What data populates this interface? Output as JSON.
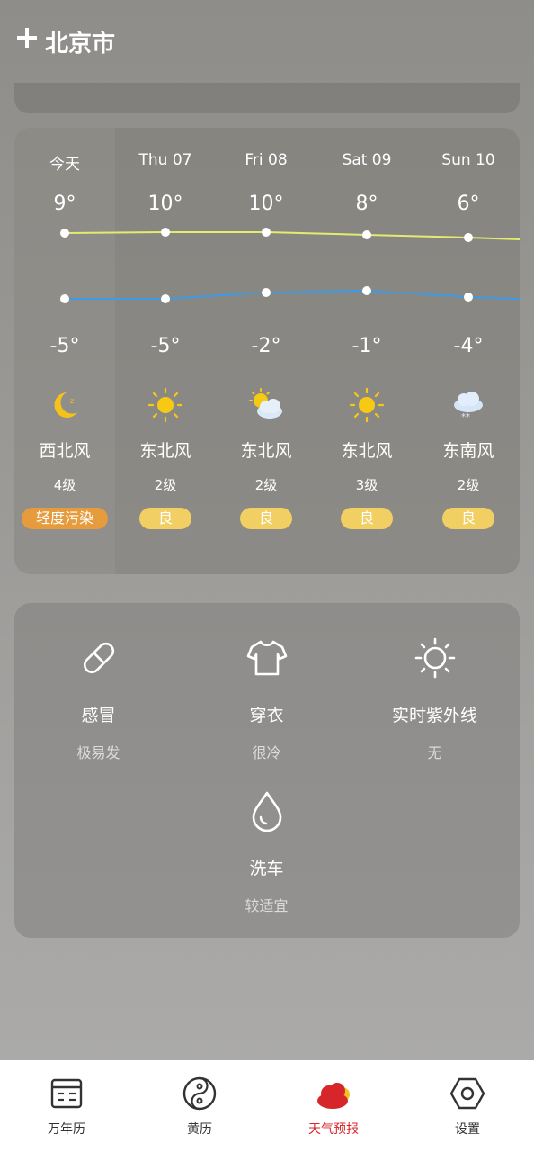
{
  "header": {
    "city": "北京市"
  },
  "forecast": {
    "days": [
      {
        "label": "今天",
        "high": "9°",
        "low": "-5°",
        "icon": "moon-icon",
        "wind": "西北风",
        "level": "4级",
        "aqi": "轻度污染"
      },
      {
        "label": "Thu 07",
        "high": "10°",
        "low": "-5°",
        "icon": "sun-icon",
        "wind": "东北风",
        "level": "2级",
        "aqi": "良"
      },
      {
        "label": "Fri 08",
        "high": "10°",
        "low": "-2°",
        "icon": "partly-cloudy-icon",
        "wind": "东北风",
        "level": "2级",
        "aqi": "良"
      },
      {
        "label": "Sat 09",
        "high": "8°",
        "low": "-1°",
        "icon": "sun-icon",
        "wind": "东北风",
        "level": "3级",
        "aqi": "良"
      },
      {
        "label": "Sun 10",
        "high": "6°",
        "low": "-4°",
        "icon": "snow-icon",
        "wind": "东南风",
        "level": "2级",
        "aqi": "良"
      }
    ],
    "colors": {
      "high_line": "#e3ec6e",
      "low_line": "#3d9be9",
      "aqi_good": "#f1cf63",
      "aqi_light": "#e69b3d"
    }
  },
  "life": [
    {
      "icon": "pill-icon",
      "name": "感冒",
      "value": "极易发"
    },
    {
      "icon": "shirt-icon",
      "name": "穿衣",
      "value": "很冷"
    },
    {
      "icon": "sun-outline-icon",
      "name": "实时紫外线",
      "value": "无"
    },
    {
      "icon": "water-drop-icon",
      "name": "洗车",
      "value": "较适宜"
    }
  ],
  "tabs": [
    {
      "label": "万年历",
      "icon": "calendar-icon"
    },
    {
      "label": "黄历",
      "icon": "yin-yang-icon"
    },
    {
      "label": "天气预报",
      "icon": "weather-cloud-icon",
      "active": true
    },
    {
      "label": "设置",
      "icon": "hex-nut-icon"
    }
  ],
  "accent": "#d6262a"
}
